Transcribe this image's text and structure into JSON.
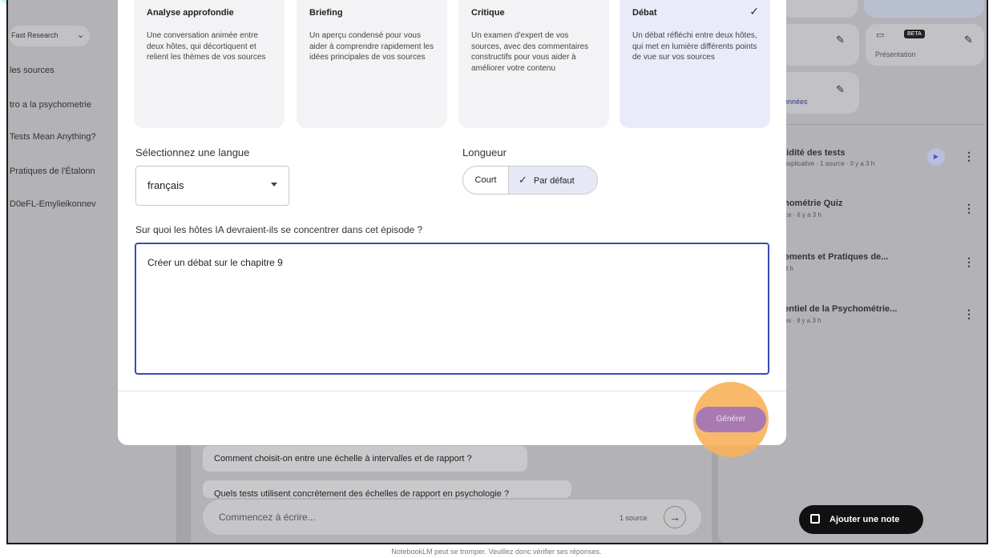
{
  "left_sidebar": {
    "dropdown_label": "Fast Research",
    "sources": [
      "les sources",
      "tro a la psychometrie",
      "Tests Mean Anything?",
      "Pratiques de l'Étalonn",
      "D0eFL-Emylieikonnev"
    ]
  },
  "right_panel": {
    "tiles": [
      {
        "label": "e"
      },
      {
        "label": "Présentation",
        "badge": "BETA"
      },
      {
        "label": "données"
      }
    ],
    "items": [
      {
        "title": "alidité des tests",
        "meta": "o explicative · 1 source · Il y a 3 h"
      },
      {
        "title": "chométrie Quiz",
        "meta": "urce · Il y a 3 h"
      },
      {
        "title": "dements et Pratiques de...",
        "meta": "a 3 h"
      },
      {
        "title": "sentiel de la Psychométrie...",
        "meta": "rces · Il y a 3 h"
      }
    ],
    "add_note": "Ajouter une note"
  },
  "modal": {
    "formats": [
      {
        "title": "Analyse approfondie",
        "desc": "Une conversation animée entre deux hôtes, qui décortiquent et relient les thèmes de vos sources"
      },
      {
        "title": "Briefing",
        "desc": "Un aperçu condensé pour vous aider à comprendre rapidement les idées principales de vos sources"
      },
      {
        "title": "Critique",
        "desc": "Un examen d'expert de vos sources, avec des commentaires constructifs pour vous aider à améliorer votre contenu"
      },
      {
        "title": "Débat",
        "desc": "Un débat réfléchi entre deux hôtes, qui met en lumière différents points de vue sur vos sources"
      }
    ],
    "language_label": "Sélectionnez une langue",
    "language_value": "français",
    "length_label": "Longueur",
    "length_options": [
      "Court",
      "Par défaut"
    ],
    "focus_label": "Sur quoi les hôtes IA devraient-ils se concentrer dans cet épisode ?",
    "focus_value": "Créer un débat sur le chapitre 9",
    "generate_label": "Générer"
  },
  "chat": {
    "suggestions": [
      "Comment choisit-on entre une échelle à intervalles et de rapport ?",
      "Quels tests utilisent concrètement des échelles de rapport en psychologie ?"
    ],
    "input_placeholder": "Commencez à écrire...",
    "source_count": "1 source"
  },
  "footer": "NotebookLM peut se tromper. Veuillez donc vérifier ses réponses.",
  "colors": {
    "accent_border": "#3b4bb3",
    "highlight": "#f7b35a",
    "generate_button": "#a97ab2"
  }
}
